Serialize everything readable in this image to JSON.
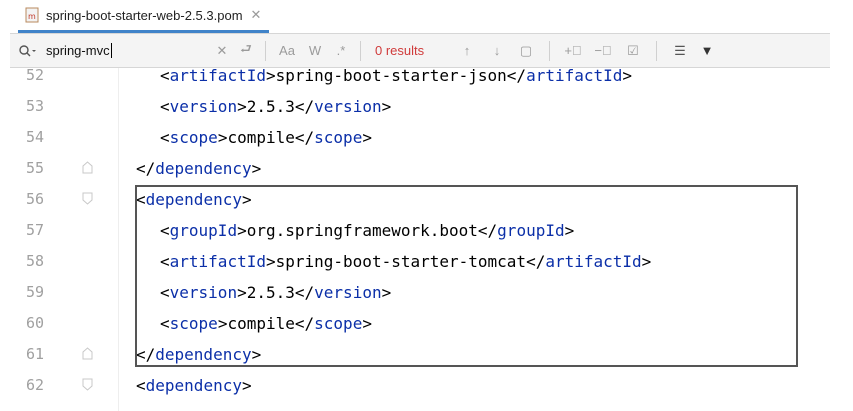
{
  "tab": {
    "title": "spring-boot-starter-web-2.5.3.pom"
  },
  "find": {
    "query": "spring-mvc",
    "match_case_label": "Aa",
    "words_label": "W",
    "regex_label": ".*",
    "results": "0 results"
  },
  "lines": [
    {
      "num": "52",
      "tag": "artifactId",
      "content": "spring-boot-starter-json",
      "indent": 2
    },
    {
      "num": "53",
      "tag": "version",
      "content": "2.5.3",
      "indent": 2
    },
    {
      "num": "54",
      "tag": "scope",
      "content": "compile",
      "indent": 2
    },
    {
      "num": "55",
      "close_only": "dependency",
      "indent": 1
    },
    {
      "num": "56",
      "open_only": "dependency",
      "indent": 1
    },
    {
      "num": "57",
      "tag": "groupId",
      "content": "org.springframework.boot",
      "indent": 2
    },
    {
      "num": "58",
      "tag": "artifactId",
      "content": "spring-boot-starter-tomcat",
      "indent": 2
    },
    {
      "num": "59",
      "tag": "version",
      "content": "2.5.3",
      "indent": 2
    },
    {
      "num": "60",
      "tag": "scope",
      "content": "compile",
      "indent": 2
    },
    {
      "num": "61",
      "close_only": "dependency",
      "indent": 1
    },
    {
      "num": "62",
      "open_only": "dependency",
      "indent": 1
    }
  ]
}
